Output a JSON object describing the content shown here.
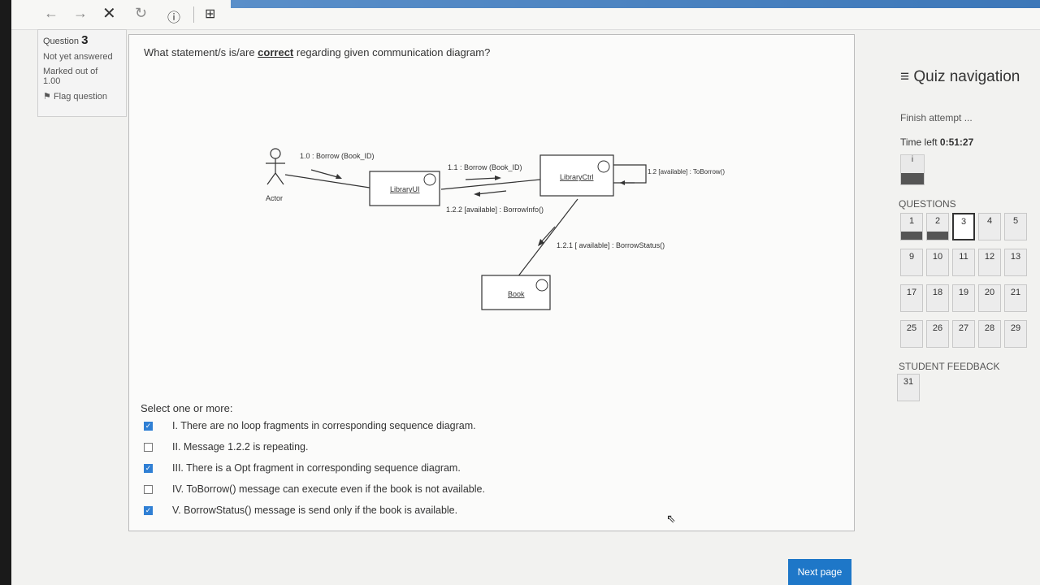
{
  "browser": {
    "back_icon": "arrow-left-icon",
    "forward_icon": "arrow-right-icon",
    "close_icon": "close-icon",
    "reload_icon": "reload-icon",
    "info_icon": "info-icon",
    "page_icon": "page-icon"
  },
  "question_info": {
    "question_label": "Question",
    "question_number": "3",
    "status": "Not yet answered",
    "marked_label": "Marked out of",
    "marked_value": "1.00",
    "flag_label": "Flag question"
  },
  "question": {
    "text_before": "What statement/s is/are ",
    "text_emph": "correct",
    "text_after": " regarding given communication diagram?",
    "select_label": "Select one or more:",
    "options": [
      {
        "label": "I. There are no loop fragments in corresponding sequence diagram.",
        "checked": true
      },
      {
        "label": "II. Message 1.2.2 is repeating.",
        "checked": false
      },
      {
        "label": "III. There is a Opt fragment in corresponding sequence diagram.",
        "checked": true
      },
      {
        "label": "IV. ToBorrow() message can execute even if the book is not available.",
        "checked": false
      },
      {
        "label": "V. BorrowStatus() message is send only if the book is available.",
        "checked": true
      }
    ]
  },
  "diagram": {
    "actor_label": "Actor",
    "library_ui": "LibraryUI",
    "library_ctrl": "LibraryCtrl",
    "book": "Book",
    "msg_1_0": "1.0 : Borrow (Book_ID)",
    "msg_1_1": "1.1 : Borrow (Book_ID)",
    "msg_1_2": "1.2 [available] : ToBorrow()",
    "msg_1_2_2": "1.2.2 [available] : BorrowInfo()",
    "msg_1_2_1": "1.2.1 [ available] : BorrowStatus()"
  },
  "quiz_nav": {
    "title": "Quiz navigation",
    "finish": "Finish attempt ...",
    "time_label": "Time left ",
    "time_value": "0:51:27",
    "info_box": "i",
    "questions_header": "QUESTIONS",
    "questions": [
      "1",
      "2",
      "3",
      "4",
      "5",
      "9",
      "10",
      "11",
      "12",
      "13",
      "17",
      "18",
      "19",
      "20",
      "21",
      "25",
      "26",
      "27",
      "28",
      "29"
    ],
    "answered": [
      "1",
      "2"
    ],
    "current": "3",
    "feedback_header": "STUDENT FEEDBACK",
    "feedback_items": [
      "31"
    ]
  },
  "next_button": "Next page"
}
